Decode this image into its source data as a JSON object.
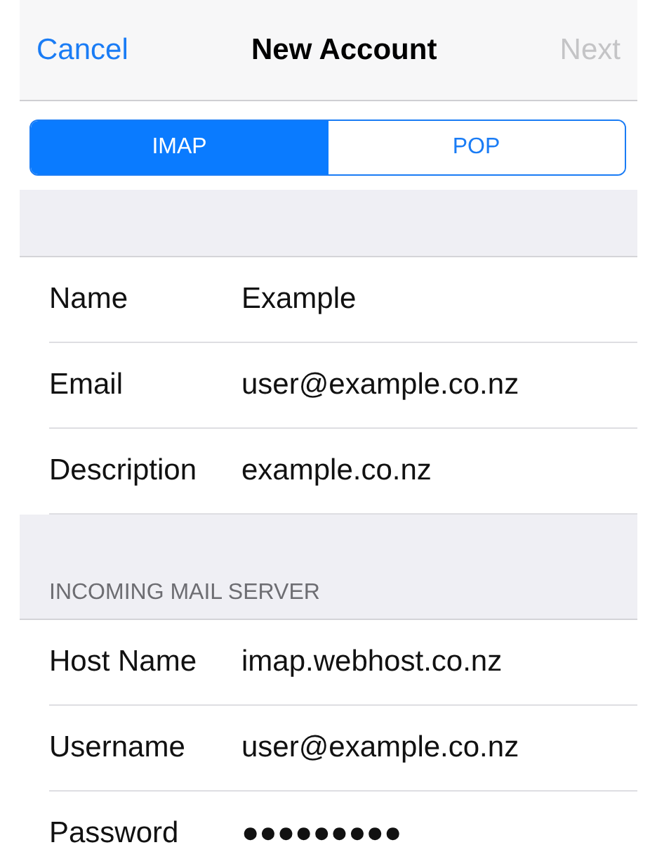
{
  "nav_bar": {
    "cancel": "Cancel",
    "title": "New Account",
    "next": {
      "label": "Next",
      "disabled": true
    }
  },
  "segments": [
    {
      "label": "IMAP",
      "selected": true
    },
    {
      "label": "POP",
      "selected": false
    }
  ],
  "sections": [
    {
      "fields": [
        {
          "label": "Name",
          "value": "Example"
        },
        {
          "label": "Email",
          "value": "user@example.co.nz"
        },
        {
          "label": "Description",
          "value": "example.co.nz"
        }
      ]
    },
    {
      "header": "INCOMING MAIL SERVER",
      "fields": [
        {
          "label": "Host Name",
          "value": "imap.webhost.co.nz"
        },
        {
          "label": "Username",
          "value": "user@example.co.nz"
        },
        {
          "label": "Password",
          "value": "●●●●●●●●●"
        }
      ]
    }
  ]
}
